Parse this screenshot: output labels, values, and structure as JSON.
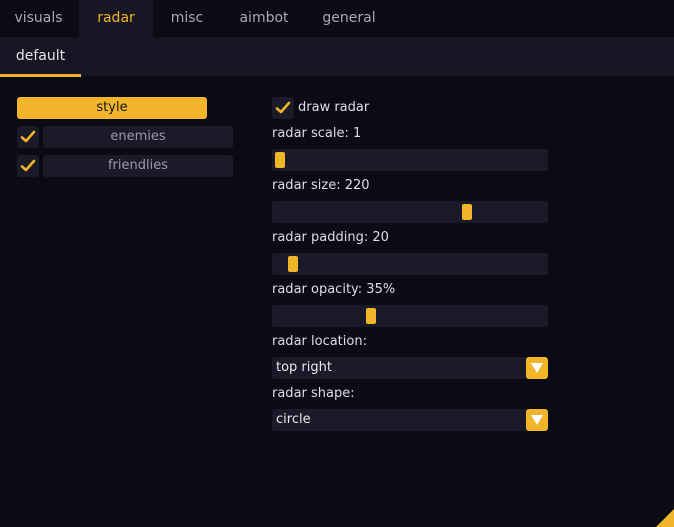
{
  "tabs": [
    "visuals",
    "radar",
    "misc",
    "aimbot",
    "general"
  ],
  "active_tab": "radar",
  "subtab": "default",
  "left": {
    "style_label": "style",
    "enemies": {
      "label": "enemies",
      "checked": true
    },
    "friendlies": {
      "label": "friendlies",
      "checked": true
    }
  },
  "right": {
    "draw_radar": {
      "label": "draw radar",
      "checked": true
    },
    "radar_scale": {
      "label": "radar scale: 1",
      "fill": 0.0
    },
    "radar_size": {
      "label": "radar size: 220",
      "fill": 0.72
    },
    "radar_padding": {
      "label": "radar padding: 20",
      "fill": 0.05
    },
    "radar_opacity": {
      "label": "radar opacity: 35%",
      "fill": 0.35
    },
    "radar_location": {
      "label": "radar location:",
      "value": "top right"
    },
    "radar_shape": {
      "label": "radar shape:",
      "value": "circle"
    }
  },
  "colors": {
    "accent": "#f1b52a",
    "background": "#0b0b16",
    "panel": "#161624",
    "control": "#1a1a28"
  },
  "icons": {
    "check": "check-icon",
    "dropdown": "chevron-down-icon",
    "resize": "resize-grip-icon"
  }
}
